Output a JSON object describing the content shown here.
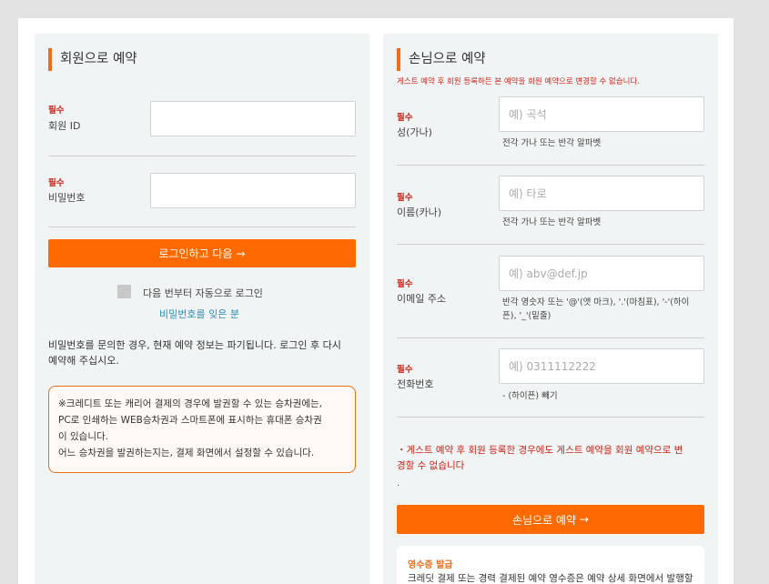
{
  "member": {
    "heading": "회원으로 예약",
    "required": "필수",
    "id_label": "회원 ID",
    "password_label": "비밀번호",
    "login_button": "로그인하고 다음",
    "autologin_label": "다음 번부터 자동으로 로그인",
    "forgot_password": "비밀번호를 잊은 분",
    "notice_line1": "비밀번호를 문의한 경우, 현재 예약 정보는 파기됩니다. 로그인 후 다시",
    "notice_line2": "예약해 주십시오.",
    "box_line1": "※크레디트 또는 캐리어 결제의 경우에 발권할 수 있는 승차권에는,",
    "box_line2": "PC로 인쇄하는 WEB승차권과 스마트폰에 표시하는 휴대폰 승차권",
    "box_line3": "이 있습니다.",
    "box_line4": "어느 승차권을 발권하는지는, 결제 화면에서 설정할 수 있습니다."
  },
  "guest": {
    "heading": "손님으로 예약",
    "subnote": "게스트 예약 후 회원 등록하든 본 예약을 회원 예약으로 변경할 수 없습니다.",
    "required": "필수",
    "surname_label": "성(가나)",
    "surname_placeholder": "예) 곡석",
    "surname_hint": "전각 가나 또는 반각 알파벳",
    "given_label": "이름(카나)",
    "given_placeholder": "예) 타로",
    "given_hint": "전각 가나 또는 반각 알파벳",
    "email_label": "이메일 주소",
    "email_placeholder": "예) abv@def.jp",
    "email_hint_line1": "반각 영숫자 또는 '@'(앳 마크), '.'(마침표), '-'(하이",
    "email_hint_line2": "픈), '_'(밑줄)",
    "phone_label": "전화번호",
    "phone_placeholder": "예) 0311112222",
    "phone_hint": "- (하이픈) 빼기",
    "warning_line1": "・게스트 예약 후 회원 등록한 경우에도 게스트 예약을 회원 예약으로 변",
    "warning_line2": "경할 수 없습니다",
    "dot": ".",
    "guest_button": "손님으로 예약",
    "receipt_title": "영수증 발급",
    "receipt_body": "크레딧 결제 또는 경력 결제된 예약 영수증은 예약 상세 화면에서 발행할"
  },
  "icons": {
    "arrow": "→"
  },
  "colors": {
    "accent": "#ff6a00",
    "required": "#cc1f12",
    "link": "#2d8cb8",
    "panel": "#f1f4f4"
  }
}
